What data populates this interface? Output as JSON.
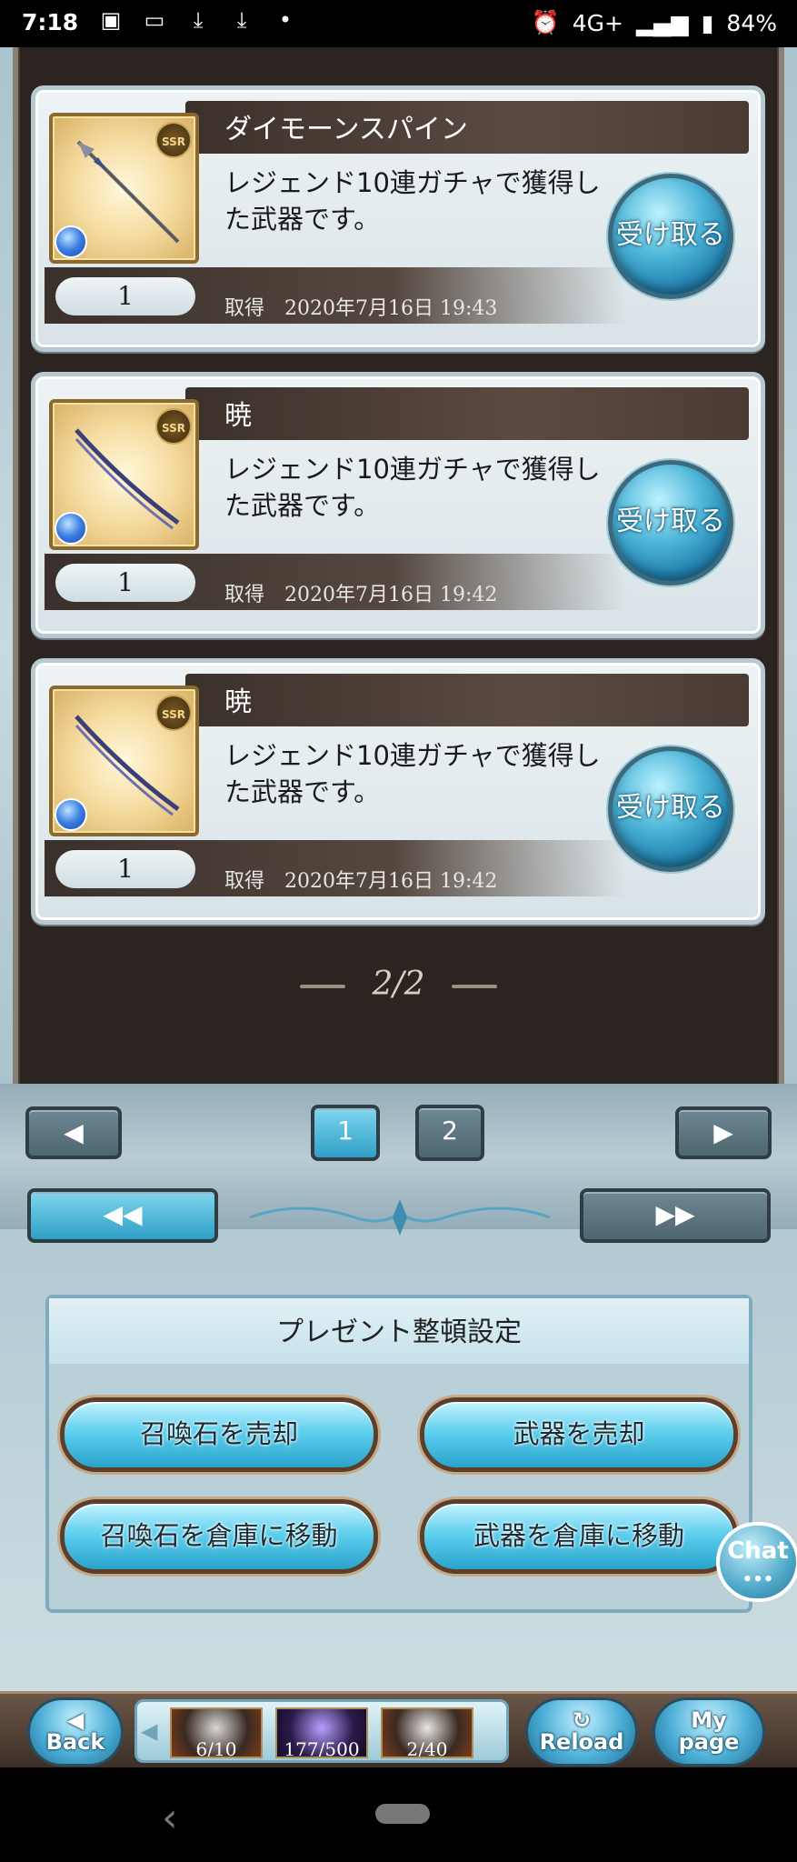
{
  "status_bar": {
    "time": "7:18",
    "icons": [
      "image-icon",
      "tv-icon",
      "download-icon",
      "download-icon",
      "dot-icon"
    ],
    "network": "4G+",
    "battery": "84%"
  },
  "items": [
    {
      "name": "ダイモーンスパイン",
      "rarity": "SSR",
      "description": "レジェンド10連ガチャで獲得した武器です。",
      "quantity": "1",
      "acquired_label": "取得",
      "acquired_date": "2020年7月16日 19:43",
      "receive_label": "受け取る"
    },
    {
      "name": "暁",
      "rarity": "SSR",
      "description": "レジェンド10連ガチャで獲得した武器です。",
      "quantity": "1",
      "acquired_label": "取得",
      "acquired_date": "2020年7月16日 19:42",
      "receive_label": "受け取る"
    },
    {
      "name": "暁",
      "rarity": "SSR",
      "description": "レジェンド10連ガチャで獲得した武器です。",
      "quantity": "1",
      "acquired_label": "取得",
      "acquired_date": "2020年7月16日 19:42",
      "receive_label": "受け取る"
    }
  ],
  "page_indicator": "2/2",
  "pager": {
    "prev": "◀",
    "pages": [
      "1",
      "2"
    ],
    "next": "▶",
    "first": "◀◀",
    "last": "▶▶"
  },
  "settings": {
    "title": "プレゼント整頓設定",
    "buttons": [
      "召喚石を売却",
      "武器を売却",
      "召喚石を倉庫に移動",
      "武器を倉庫に移動"
    ]
  },
  "chat": {
    "label": "Chat",
    "dots": "•••"
  },
  "bottom_nav": {
    "back": "Back",
    "reload": "Reload",
    "mypage_line1": "My",
    "mypage_line2": "page",
    "resources": [
      "6/10",
      "177/500",
      "2/40"
    ]
  }
}
